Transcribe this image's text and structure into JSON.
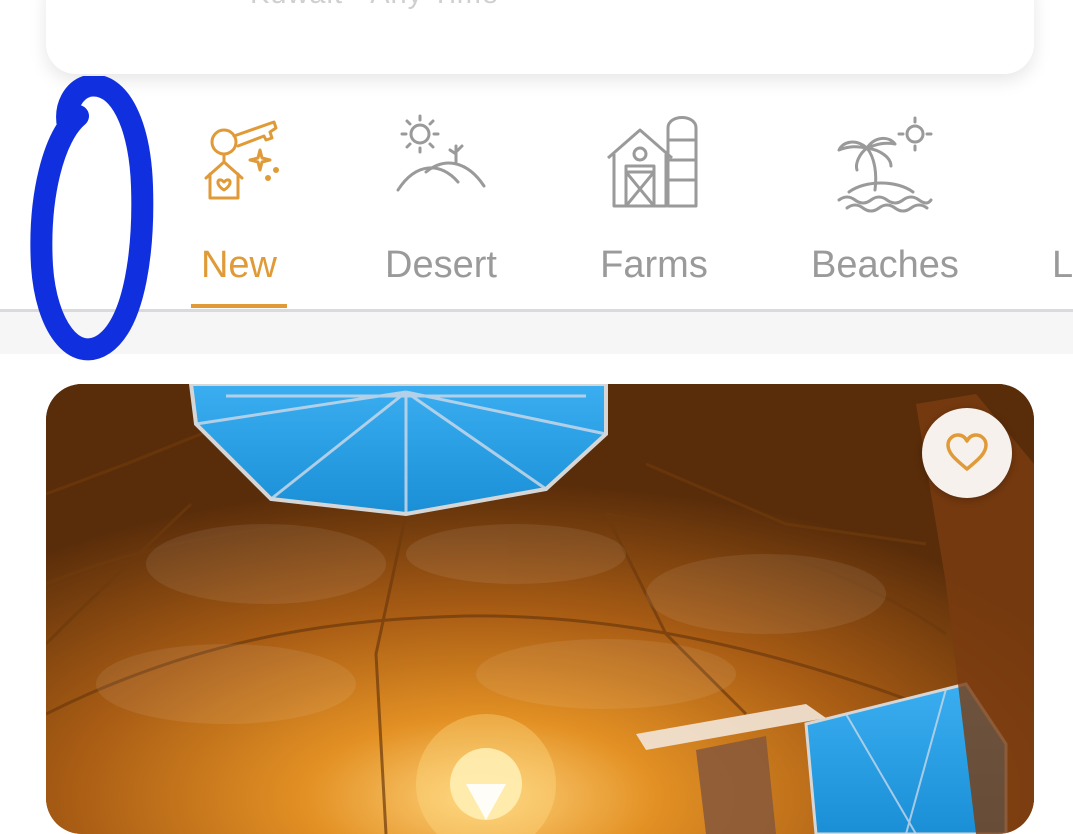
{
  "search": {
    "placeholder": "Kuwait - Any Time"
  },
  "categories": [
    {
      "label": "New",
      "icon": "house-key-icon",
      "active": true
    },
    {
      "label": "Desert",
      "icon": "desert-sun-icon",
      "active": false
    },
    {
      "label": "Farms",
      "icon": "barn-icon",
      "active": false
    },
    {
      "label": "Beaches",
      "icon": "palm-island-icon",
      "active": false
    },
    {
      "label": "L",
      "icon": "",
      "active": false
    }
  ],
  "colors": {
    "accent": "#e09a37",
    "inactive_text": "#9a9a9a",
    "marker": "#1030e0"
  },
  "listing": {
    "image": "geodesic-dome-tent-interior",
    "favorite": false
  }
}
